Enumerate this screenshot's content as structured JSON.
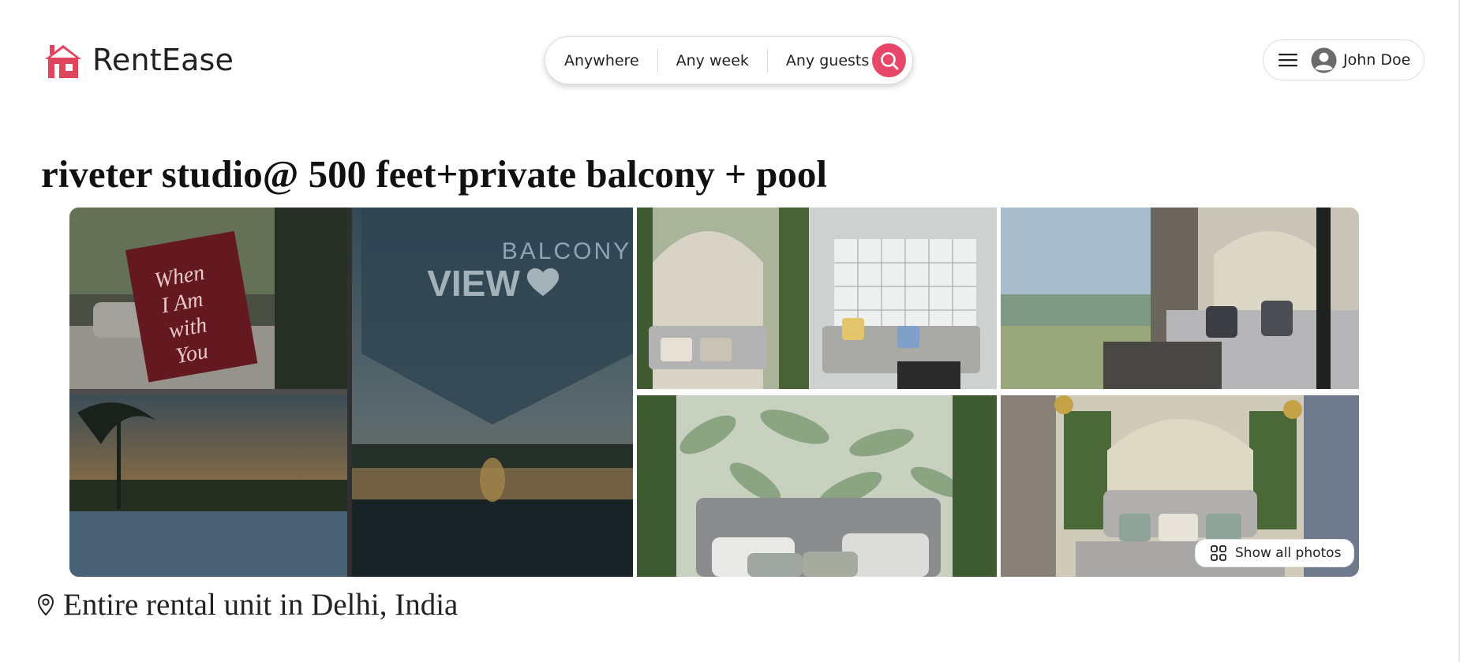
{
  "brand": {
    "name": "RentEase",
    "accent": "#e8476a"
  },
  "search": {
    "where": "Anywhere",
    "when": "Any week",
    "who": "Any guests",
    "button_icon": "search-icon"
  },
  "user_menu": {
    "menu_icon": "hamburger-icon",
    "avatar_icon": "user-avatar-icon",
    "name": "John Doe"
  },
  "listing": {
    "title": "riveter studio@ 500 feet+private balcony + pool",
    "location": "Entire rental unit in Delhi, India"
  },
  "gallery": {
    "show_all_label": "Show all photos",
    "photos": [
      {
        "name": "photo-collage-main",
        "overlay_text": [
          "When",
          "I Am",
          "with",
          "You"
        ],
        "caption_a": "BALCONY",
        "caption_b": "VIEW"
      },
      {
        "name": "photo-living-room"
      },
      {
        "name": "photo-bedroom-balcony"
      },
      {
        "name": "photo-bed-tropical-wallpaper"
      },
      {
        "name": "photo-bedroom-wide"
      }
    ]
  }
}
